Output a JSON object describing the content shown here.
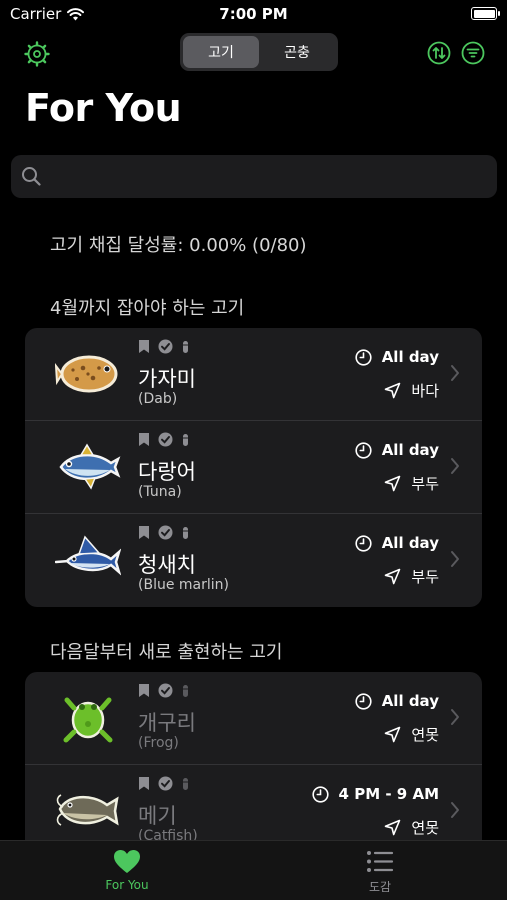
{
  "status": {
    "carrier": "Carrier",
    "time": "7:00 PM"
  },
  "nav": {
    "segments": [
      {
        "label": "고기",
        "active": true
      },
      {
        "label": "곤충",
        "active": false
      }
    ]
  },
  "title": "For You",
  "search": {
    "placeholder": ""
  },
  "completion": "고기 채집 달성률:  0.00% (0/80)",
  "sections": [
    {
      "title": "4월까지 잡아야 하는 고기",
      "items": [
        {
          "name_ko": "가자미",
          "name_en": "(Dab)",
          "time": "All day",
          "place": "바다",
          "dim": false
        },
        {
          "name_ko": "다랑어",
          "name_en": "(Tuna)",
          "time": "All day",
          "place": "부두",
          "dim": false
        },
        {
          "name_ko": "청새치",
          "name_en": "(Blue marlin)",
          "time": "All day",
          "place": "부두",
          "dim": false
        }
      ]
    },
    {
      "title": "다음달부터 새로 출현하는 고기",
      "items": [
        {
          "name_ko": "개구리",
          "name_en": "(Frog)",
          "time": "All day",
          "place": "연못",
          "dim": true
        },
        {
          "name_ko": "메기",
          "name_en": "(Catfish)",
          "time": "4 PM - 9 AM",
          "place": "연못",
          "dim": true
        }
      ]
    }
  ],
  "tabs": [
    {
      "label": "For You",
      "active": true
    },
    {
      "label": "도감",
      "active": false
    }
  ],
  "colors": {
    "accent": "#4cc75e",
    "background": "#000000",
    "card": "#1c1c1e"
  }
}
